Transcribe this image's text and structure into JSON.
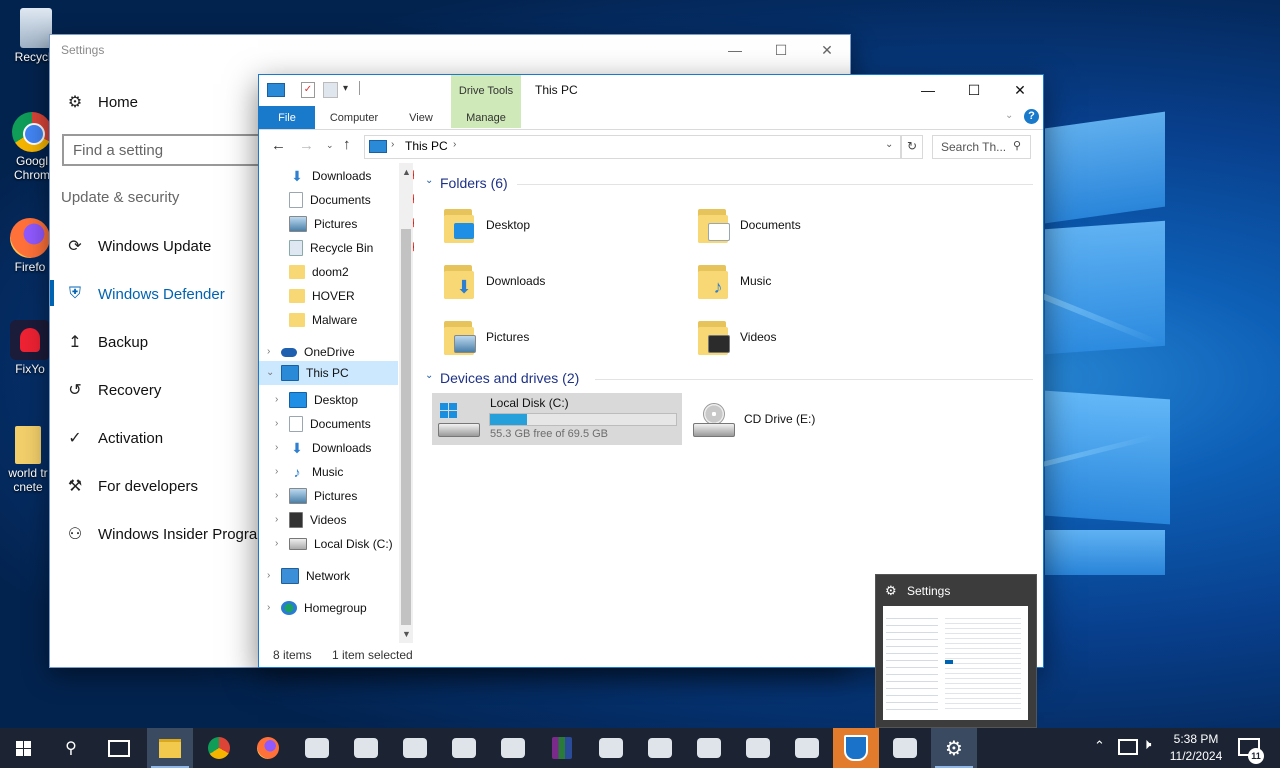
{
  "desktop": {
    "icons": [
      {
        "label": "Recycle"
      },
      {
        "label": "Googl Chrom"
      },
      {
        "label": "Firefo"
      },
      {
        "label": "FixYo"
      },
      {
        "label": "world tr cnete"
      }
    ]
  },
  "settings": {
    "title": "Settings",
    "home": "Home",
    "search_placeholder": "Find a setting",
    "section": "Update & security",
    "nav": [
      {
        "label": "Windows Update",
        "icon": "refresh-icon"
      },
      {
        "label": "Windows Defender",
        "icon": "shield-icon",
        "active": true
      },
      {
        "label": "Backup",
        "icon": "upload-arrow-icon"
      },
      {
        "label": "Recovery",
        "icon": "history-icon"
      },
      {
        "label": "Activation",
        "icon": "check-circle-icon"
      },
      {
        "label": "For developers",
        "icon": "tools-icon"
      },
      {
        "label": "Windows Insider Program",
        "icon": "person-gear-icon"
      }
    ],
    "accent": "#0063b1"
  },
  "explorer": {
    "title": "This PC",
    "contextual_group": "Drive Tools",
    "tabs": {
      "file": "File",
      "computer": "Computer",
      "view": "View",
      "manage": "Manage"
    },
    "address": {
      "location": "This PC"
    },
    "search_placeholder": "Search Th...",
    "tree": {
      "quick_access": [
        {
          "label": "Downloads",
          "pinned": true
        },
        {
          "label": "Documents",
          "pinned": true
        },
        {
          "label": "Pictures",
          "pinned": true
        },
        {
          "label": "Recycle Bin",
          "pinned": true
        },
        {
          "label": "doom2"
        },
        {
          "label": "HOVER"
        },
        {
          "label": "Malware"
        }
      ],
      "onedrive": "OneDrive",
      "this_pc": "This PC",
      "this_pc_children": [
        "Desktop",
        "Documents",
        "Downloads",
        "Music",
        "Pictures",
        "Videos",
        "Local Disk (C:)"
      ],
      "network": "Network",
      "homegroup": "Homegroup"
    },
    "groups": {
      "folders_header": "Folders (6)",
      "drives_header": "Devices and drives (2)"
    },
    "folders": [
      "Desktop",
      "Documents",
      "Downloads",
      "Music",
      "Pictures",
      "Videos"
    ],
    "drives": {
      "local": {
        "name": "Local Disk (C:)",
        "free_text": "55.3 GB free of 69.5 GB",
        "used_fraction": 0.2
      },
      "cd": {
        "name": "CD Drive (E:)"
      }
    },
    "status": {
      "items": "8 items",
      "selected": "1 item selected"
    }
  },
  "preview": {
    "title": "Settings"
  },
  "taskbar": {
    "time": "5:38 PM",
    "date": "11/2/2024",
    "notification_count": "11"
  }
}
